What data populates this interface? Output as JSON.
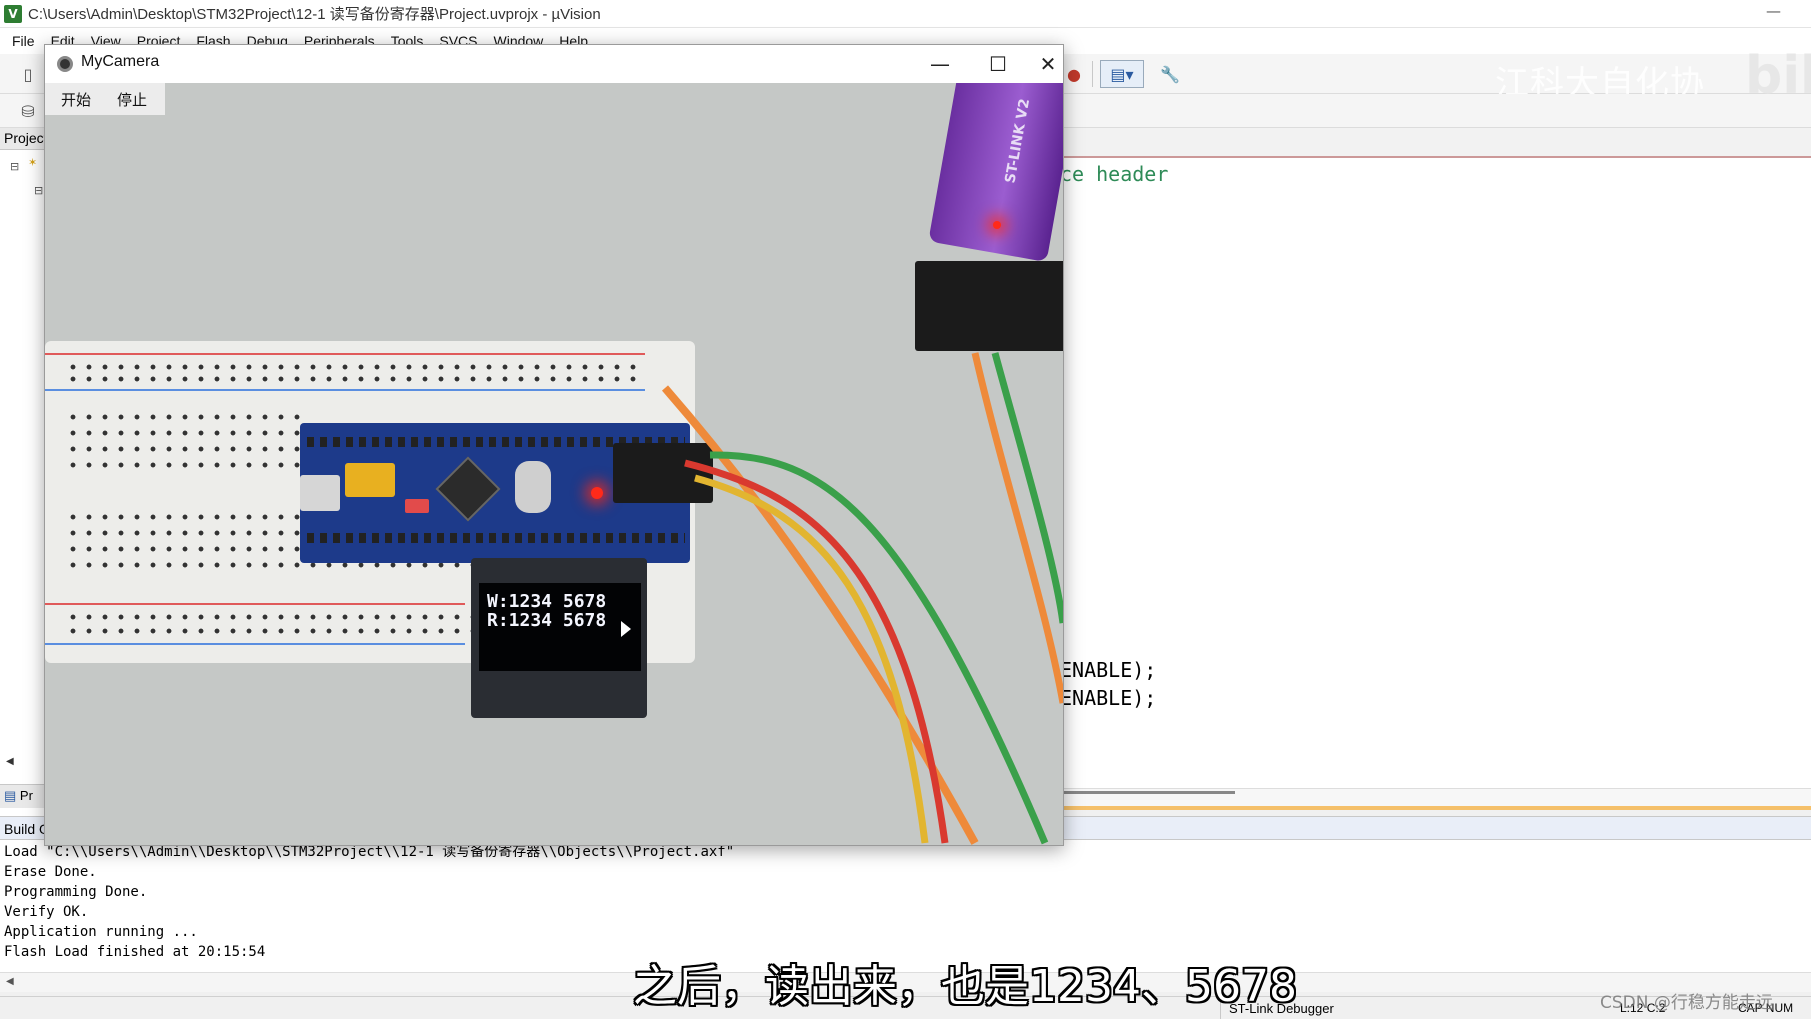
{
  "window": {
    "title": "C:\\Users\\Admin\\Desktop\\STM32Project\\12-1 读写备份寄存器\\Project.uvprojx - µVision",
    "app_icon": "uvision-icon",
    "minimize_glyph": "—"
  },
  "menu": [
    "File",
    "Edit",
    "View",
    "Project",
    "Flash",
    "Debug",
    "Peripherals",
    "Tools",
    "SVCS",
    "Window",
    "Help"
  ],
  "project_panel": {
    "title": "Project",
    "tab_label": "Pr"
  },
  "editor": {
    "lines": [
      {
        "text": "ce header",
        "kind": "comment"
      },
      {
        "text": "ENABLE);",
        "kind": "plain"
      },
      {
        "text": "ENABLE);",
        "kind": "plain"
      }
    ]
  },
  "build_output": {
    "title": "Build Output",
    "lines": [
      "Load \"C:\\\\Users\\\\Admin\\\\Desktop\\\\STM32Project\\\\12-1 读写备份寄存器\\\\Objects\\\\Project.axf\"",
      "Erase Done.",
      "Programming Done.",
      "Verify OK.",
      "Application running ...",
      "Flash Load finished at 20:15:54"
    ]
  },
  "status": {
    "debugger": "ST-Link Debugger",
    "position": "L:12 C:2",
    "keys": "CAP  NUM"
  },
  "camera": {
    "title": "MyCamera",
    "start_button": "开始",
    "stop_button": "停止",
    "oled_line1": "W:1234 5678",
    "oled_line2": "R:1234 5678",
    "stlink_label": "ST-LINK V2"
  },
  "overlay": {
    "subtitle": "之后，读出来，也是1234、5678",
    "watermark_top": "江科大自化协",
    "watermark_bili": "bili",
    "watermark_csdn": "CSDN @行稳方能走远"
  },
  "colors": {
    "comment": "#2e8b57",
    "oled_text": "#f4f6ff",
    "stlink": "#8a4fc4"
  }
}
